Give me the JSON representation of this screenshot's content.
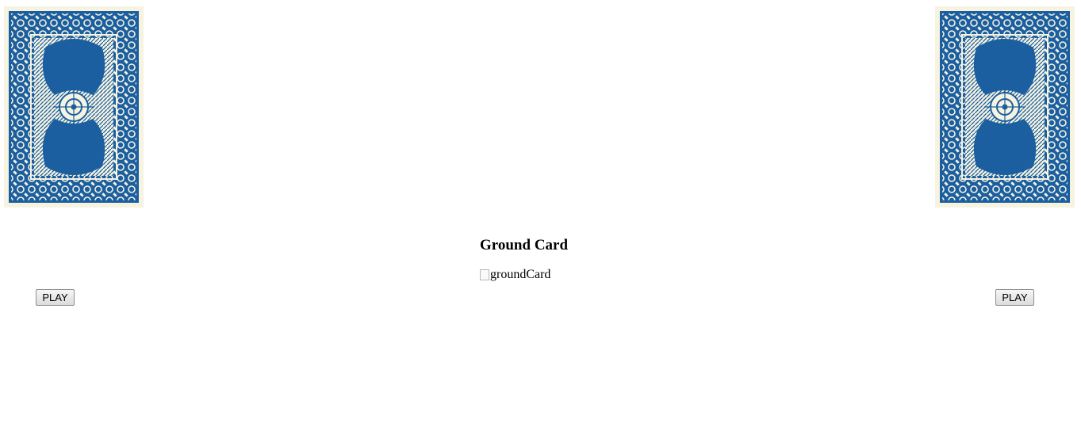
{
  "players": {
    "left": {
      "play_label": "PLAY"
    },
    "right": {
      "play_label": "PLAY"
    }
  },
  "ground": {
    "title": "Ground Card",
    "image_alt": "groundCard"
  },
  "colors": {
    "card_blue": "#1b5fa0",
    "card_cream": "#f6f3e1"
  },
  "icons": {
    "card_back": "card-back-icon",
    "broken_image": "broken-image-icon"
  }
}
